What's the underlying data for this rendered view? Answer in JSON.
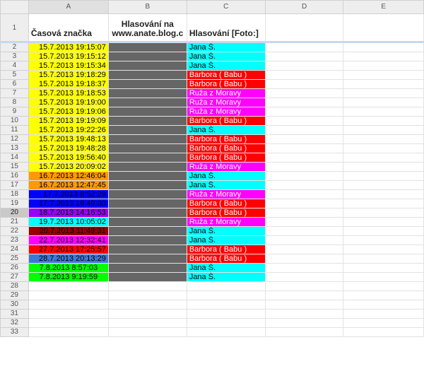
{
  "columns": [
    "A",
    "B",
    "C",
    "D",
    "E"
  ],
  "header_row_number": "1",
  "headers": {
    "A": "Časová značka",
    "B": "Hlasování na www.anate.blog.c",
    "C": "Hlasování [Foto:]"
  },
  "colors": {
    "yellow": "#ffff00",
    "orange": "#ff9900",
    "blue": "#0000ff",
    "violet": "#9900ff",
    "cyan": "#00ffff",
    "darkred": "#980000",
    "magenta": "#ff00ff",
    "red": "#ff0000",
    "cornflower": "#3c78d8",
    "green": "#00ff00",
    "gray": "#666666",
    "vote_jana": "#00ffff",
    "vote_barbora": "#ff0000",
    "vote_ruza": "#ff00ff"
  },
  "selected_row": "20",
  "rows": [
    {
      "n": "2",
      "ts": "15.7.2013 19:15:07",
      "bg": "yellow",
      "vote": "Jana Š.",
      "vbg": "vote_jana"
    },
    {
      "n": "3",
      "ts": "15.7.2013 19:15:12",
      "bg": "yellow",
      "vote": "Jana Š.",
      "vbg": "vote_jana"
    },
    {
      "n": "4",
      "ts": "15.7.2013 19:15:34",
      "bg": "yellow",
      "vote": "Jana Š.",
      "vbg": "vote_jana"
    },
    {
      "n": "5",
      "ts": "15.7.2013 19:18:29",
      "bg": "yellow",
      "vote": "Barbora ( Babu )",
      "vbg": "vote_barbora"
    },
    {
      "n": "6",
      "ts": "15.7.2013 19:18:37",
      "bg": "yellow",
      "vote": "Barbora ( Babu )",
      "vbg": "vote_barbora"
    },
    {
      "n": "7",
      "ts": "15.7.2013 19:18:53",
      "bg": "yellow",
      "vote": "Ruža z Moravy",
      "vbg": "vote_ruza"
    },
    {
      "n": "8",
      "ts": "15.7.2013 19:19:00",
      "bg": "yellow",
      "vote": "Ruža z Moravy",
      "vbg": "vote_ruza"
    },
    {
      "n": "9",
      "ts": "15.7.2013 19:19:06",
      "bg": "yellow",
      "vote": "Ruža z Moravy",
      "vbg": "vote_ruza"
    },
    {
      "n": "10",
      "ts": "15.7.2013 19:19:09",
      "bg": "yellow",
      "vote": "Barbora ( Babu )",
      "vbg": "vote_barbora"
    },
    {
      "n": "11",
      "ts": "15.7.2013 19:22:26",
      "bg": "yellow",
      "vote": "Jana Š.",
      "vbg": "vote_jana"
    },
    {
      "n": "12",
      "ts": "15.7.2013 19:48:13",
      "bg": "yellow",
      "vote": "Barbora ( Babu )",
      "vbg": "vote_barbora"
    },
    {
      "n": "13",
      "ts": "15.7.2013 19:48:28",
      "bg": "yellow",
      "vote": "Barbora ( Babu )",
      "vbg": "vote_barbora"
    },
    {
      "n": "14",
      "ts": "15.7.2013 19:56:40",
      "bg": "yellow",
      "vote": "Barbora ( Babu )",
      "vbg": "vote_barbora"
    },
    {
      "n": "15",
      "ts": "15.7.2013 20:09:02",
      "bg": "yellow",
      "vote": "Ruža z Moravy",
      "vbg": "vote_ruza"
    },
    {
      "n": "16",
      "ts": "16.7.2013 12:46:04",
      "bg": "orange",
      "vote": "Jana Š.",
      "vbg": "vote_jana"
    },
    {
      "n": "17",
      "ts": "16.7.2013 12:47:45",
      "bg": "orange",
      "vote": "Jana Š.",
      "vbg": "vote_jana"
    },
    {
      "n": "18",
      "ts": "17.7.2013 8:52:29",
      "bg": "blue",
      "vote": "Ruža z Moravy",
      "vbg": "vote_ruza"
    },
    {
      "n": "19",
      "ts": "17.7.2013 16:49:00",
      "bg": "blue",
      "vote": "Barbora ( Babu )",
      "vbg": "vote_barbora"
    },
    {
      "n": "20",
      "ts": "18.7.2013 14:16:53",
      "bg": "violet",
      "vote": "Barbora ( Babu )",
      "vbg": "vote_barbora"
    },
    {
      "n": "21",
      "ts": "19.7.2013 10:05:02",
      "bg": "cyan",
      "vote": "Ruža z Moravy",
      "vbg": "vote_ruza"
    },
    {
      "n": "22",
      "ts": "20.7.2013 11:49:31",
      "bg": "darkred",
      "vote": "Jana Š.",
      "vbg": "vote_jana"
    },
    {
      "n": "23",
      "ts": "22.7.2013 12:32:41",
      "bg": "magenta",
      "vote": "Jana Š.",
      "vbg": "vote_jana"
    },
    {
      "n": "24",
      "ts": "27.7.2013 17:25:57",
      "bg": "red",
      "vote": "Barbora ( Babu )",
      "vbg": "vote_barbora"
    },
    {
      "n": "25",
      "ts": "28.7.2013 20:13:29",
      "bg": "cornflower",
      "vote": "Barbora ( Babu )",
      "vbg": "vote_barbora"
    },
    {
      "n": "26",
      "ts": "7.8.2013 8:57:03",
      "bg": "green",
      "vote": "Jana Š.",
      "vbg": "vote_jana"
    },
    {
      "n": "27",
      "ts": "7.8.2013 9:19:59",
      "bg": "green",
      "vote": "Jana Š.",
      "vbg": "vote_jana"
    }
  ],
  "empty_rows": [
    "28",
    "29",
    "30",
    "31",
    "32",
    "33"
  ]
}
